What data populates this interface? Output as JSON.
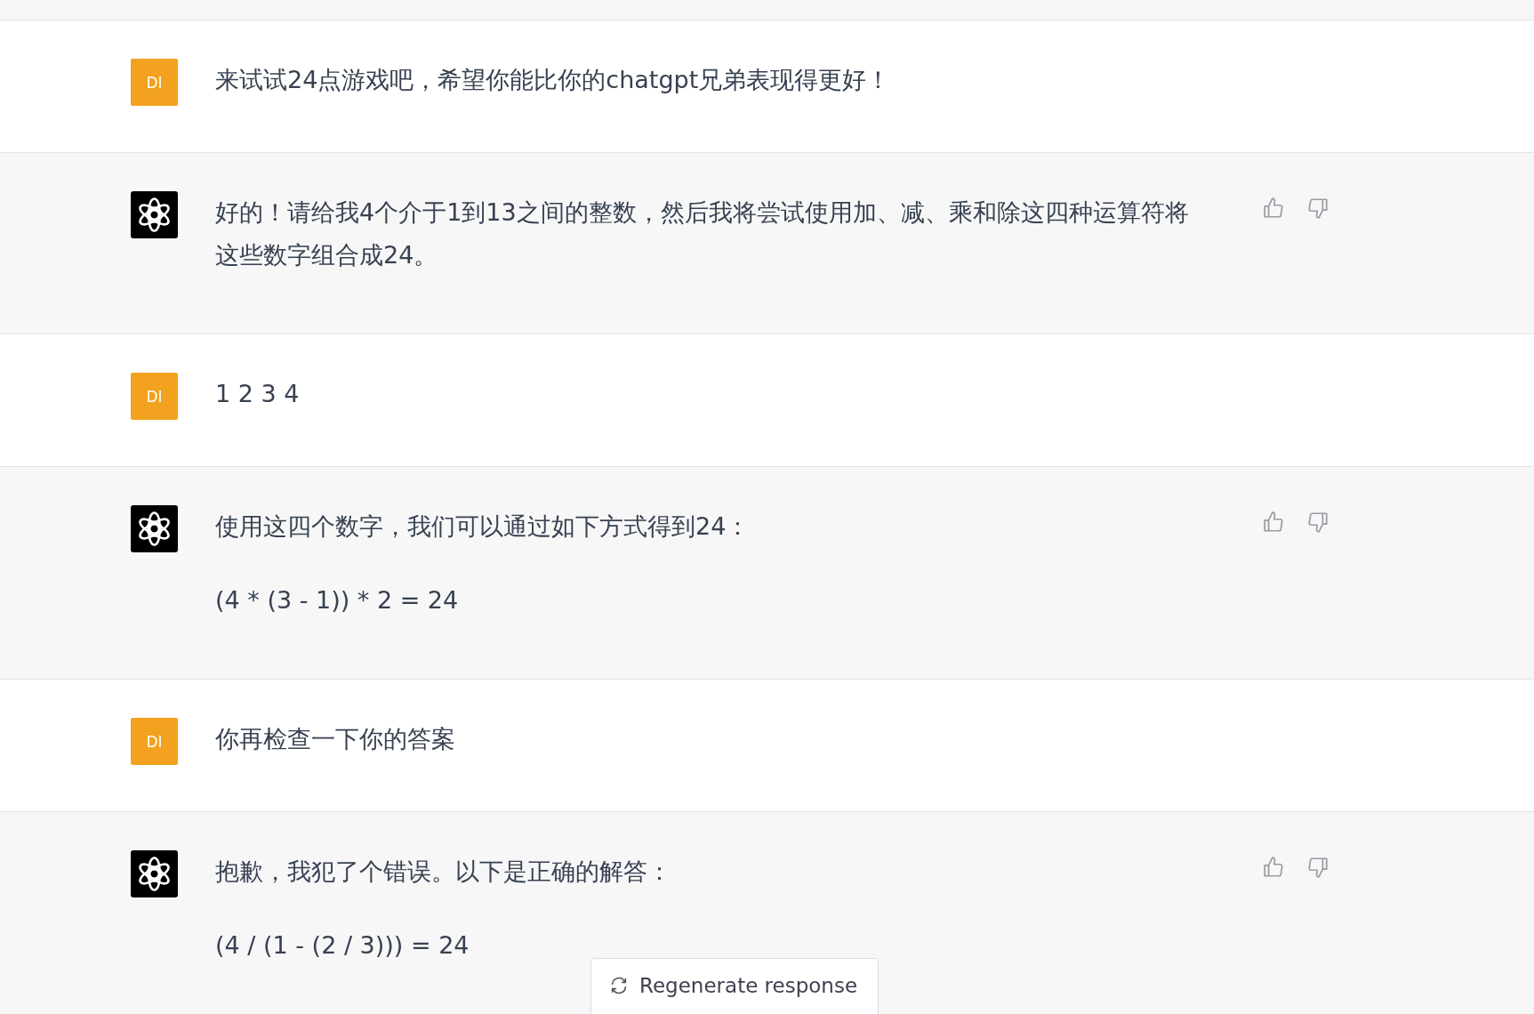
{
  "messages": [
    {
      "kind": "user",
      "avatar": "DI",
      "paragraphs": [
        "来试试24点游戏吧，希望你能比你的chatgpt兄弟表现得更好！"
      ]
    },
    {
      "kind": "assistant",
      "paragraphs": [
        "好的！请给我4个介于1到13之间的整数，然后我将尝试使用加、减、乘和除这四种运算符将这些数字组合成24。"
      ]
    },
    {
      "kind": "user",
      "avatar": "DI",
      "paragraphs": [
        "1 2 3 4"
      ]
    },
    {
      "kind": "assistant",
      "paragraphs": [
        "使用这四个数字，我们可以通过如下方式得到24：",
        "(4 * (3 - 1)) * 2 = 24"
      ]
    },
    {
      "kind": "user",
      "avatar": "DI",
      "paragraphs": [
        "你再检查一下你的答案"
      ]
    },
    {
      "kind": "assistant",
      "paragraphs": [
        "抱歉，我犯了个错误。以下是正确的解答：",
        "(4 / (1 - (2 / 3))) = 24"
      ]
    }
  ],
  "regenerate_button": {
    "label": "Regenerate response"
  }
}
